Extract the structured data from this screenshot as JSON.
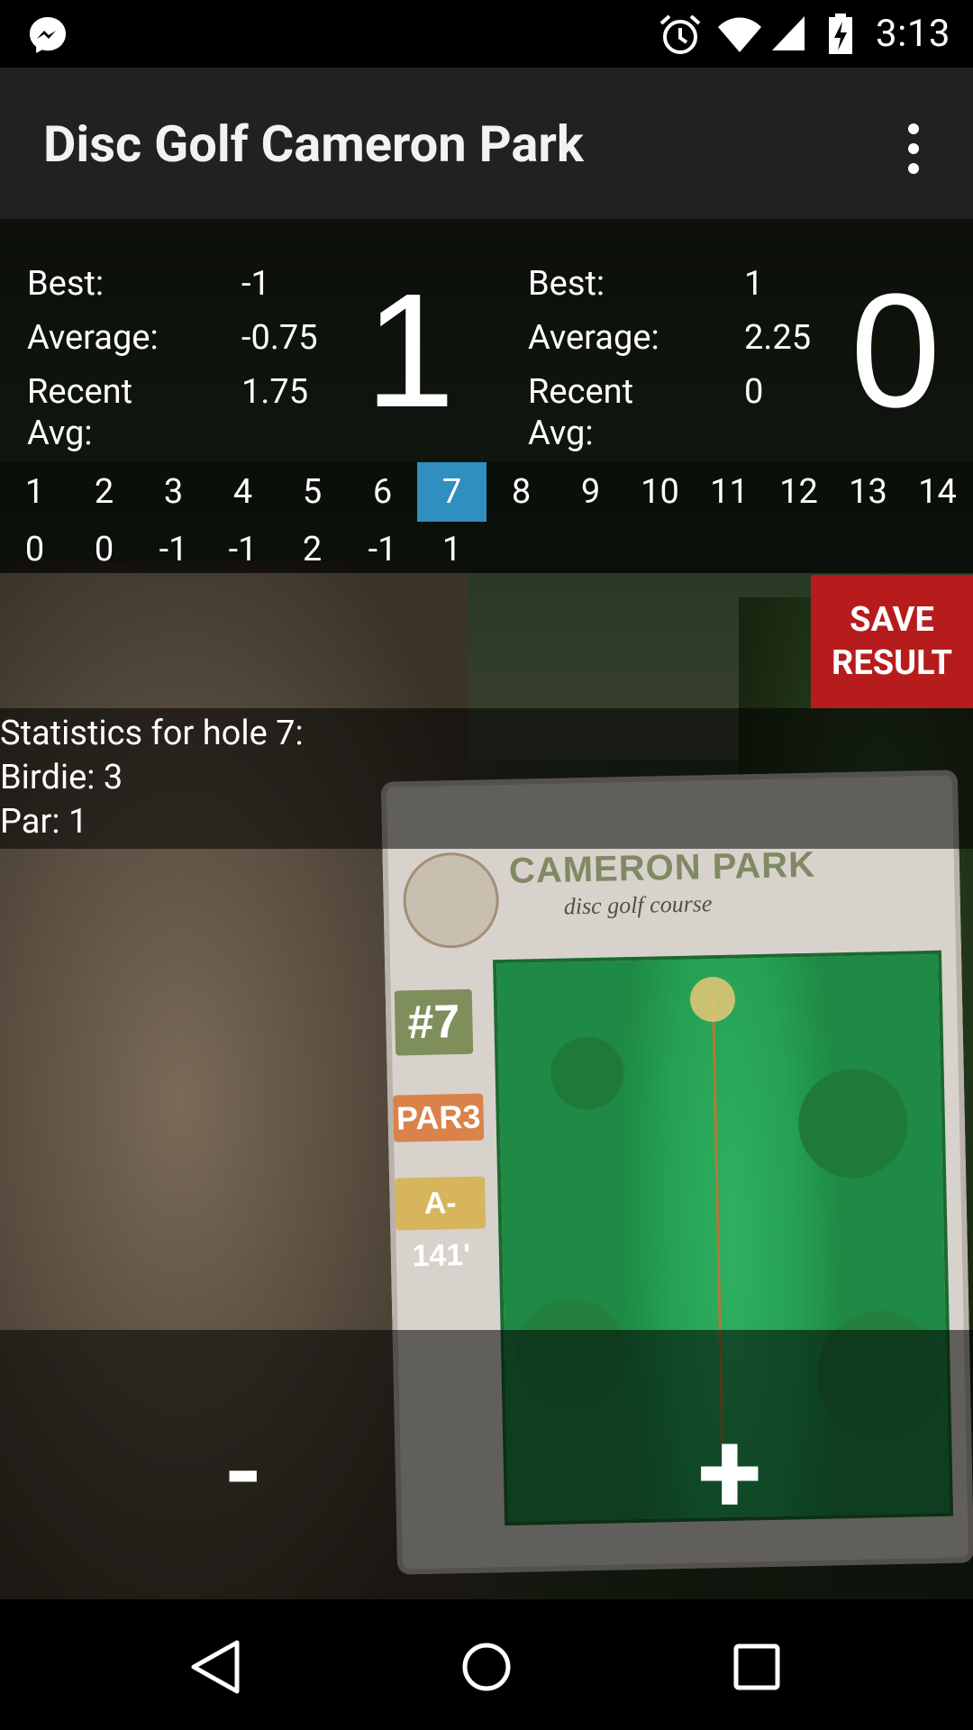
{
  "status_bar": {
    "time": "3:13",
    "icons": [
      "messenger-icon",
      "alarm-icon",
      "wifi-icon",
      "signal-icon",
      "battery-charging-icon"
    ]
  },
  "toolbar": {
    "title": "Disc Golf Cameron Park",
    "overflow_icon": "more-vert-icon"
  },
  "stats_left": {
    "best_label": "Best:",
    "best_value": "-1",
    "average_label": "Average:",
    "average_value": "-0.75",
    "recent_label": "Recent Avg:",
    "recent_value": "1.75",
    "big_value": "1"
  },
  "stats_right": {
    "best_label": "Best:",
    "best_value": "1",
    "average_label": "Average:",
    "average_value": "2.25",
    "recent_label": "Recent Avg:",
    "recent_value": "0",
    "big_value": "0"
  },
  "holes": {
    "numbers": [
      "1",
      "2",
      "3",
      "4",
      "5",
      "6",
      "7",
      "8",
      "9",
      "10",
      "11",
      "12",
      "13",
      "14"
    ],
    "scores": [
      "0",
      "0",
      "-1",
      "-1",
      "2",
      "-1",
      "1"
    ],
    "selected": "7",
    "selected_color": "#2f8fbf"
  },
  "save_button": {
    "line1": "SAVE",
    "line2": "RESULT",
    "color": "#b71c1c"
  },
  "hole_stats": {
    "title": "Statistics for hole 7:",
    "birdie": "Birdie: 3",
    "par": "Par: 1"
  },
  "photo_sign": {
    "title": "CAMERON PARK",
    "subtitle": "disc golf course",
    "hole_tag": "#7",
    "par_tag": "PAR3",
    "length_tag": "A-141'"
  },
  "controls": {
    "minus_label": "-",
    "plus_label": "+"
  },
  "nav_bar": {
    "icons": [
      "back-icon",
      "home-icon",
      "recents-icon"
    ]
  }
}
